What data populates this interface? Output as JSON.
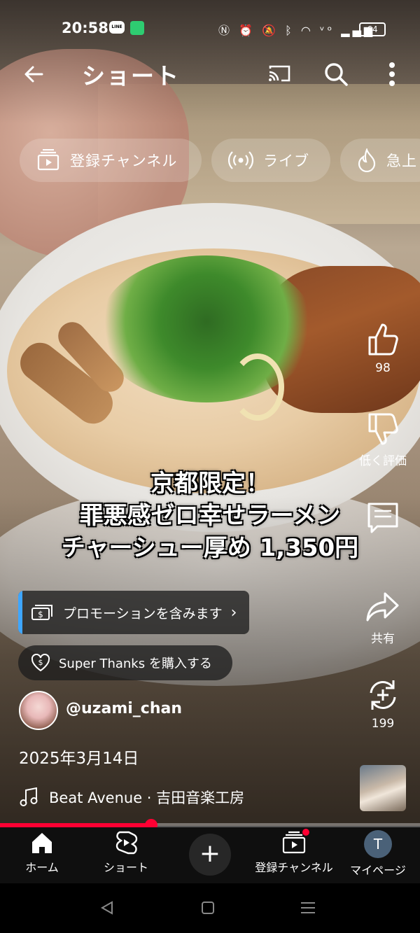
{
  "status_bar": {
    "time": "20:58",
    "line_icon_text": "LINE",
    "battery": "64",
    "icons": [
      "line-icon",
      "app-icon",
      "nfc-icon",
      "alarm-icon",
      "mute-icon",
      "bluetooth-icon",
      "wifi-icon",
      "volte-icon",
      "signal-icon",
      "battery-icon"
    ]
  },
  "app_bar": {
    "title": "ショート",
    "icons": [
      "back-arrow-icon",
      "cast-icon",
      "search-icon",
      "more-vert-icon"
    ]
  },
  "chips": [
    {
      "label": "登録チャンネル",
      "icon": "subscriptions-icon"
    },
    {
      "label": "ライブ",
      "icon": "live-icon"
    },
    {
      "label": "急上",
      "icon": "trending-icon"
    }
  ],
  "actions": {
    "like_count": "98",
    "dislike_label": "低く評価",
    "comments_label": "",
    "share_label": "共有",
    "remix_count": "199"
  },
  "caption": {
    "line1": "京都限定！",
    "line2": "罪悪感ゼロ幸せラーメン",
    "line3": "チャーシュー厚め 1,350円"
  },
  "promo": {
    "label": "プロモーションを含みます",
    "chevron": "›"
  },
  "super_thanks": {
    "label": "Super Thanks を購入する"
  },
  "channel": {
    "handle": "@uzami_chan"
  },
  "video": {
    "date": "2025年3月14日",
    "music": "Beat Avenue · 吉田音楽工房",
    "progress": 0.36
  },
  "bottom_nav": [
    {
      "label": "ホーム",
      "icon": "home-icon"
    },
    {
      "label": "ショート",
      "icon": "shorts-icon"
    },
    {
      "label": "",
      "icon": "create-plus-icon"
    },
    {
      "label": "登録チャンネル",
      "icon": "subscriptions-icon"
    },
    {
      "label": "マイページ",
      "icon": "account-avatar"
    }
  ],
  "account_initial": "T",
  "accent_color": "#ff0033"
}
